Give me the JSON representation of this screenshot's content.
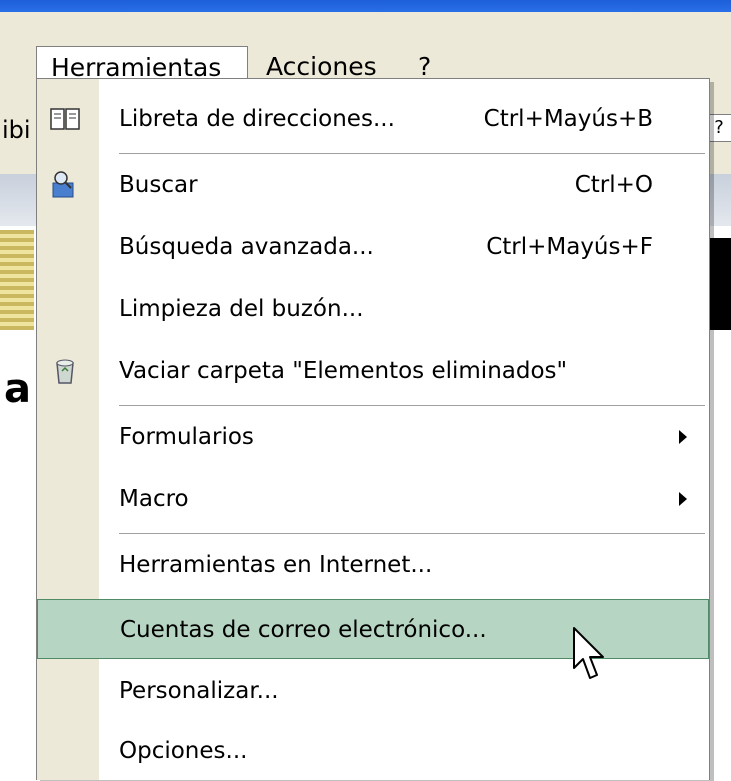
{
  "menubar": {
    "items": [
      {
        "label": "Herramientas"
      },
      {
        "label": "Acciones"
      },
      {
        "label": "?"
      }
    ]
  },
  "background": {
    "left_fragment": "ibi",
    "big_letter": "a",
    "help_glyph": "?"
  },
  "menu": {
    "items": [
      {
        "label": "Libreta de direcciones...",
        "shortcut": "Ctrl+Mayús+B",
        "icon": "address-book-icon"
      },
      {
        "label": "Buscar",
        "shortcut": "Ctrl+O",
        "icon": "find-icon"
      },
      {
        "label": "Búsqueda avanzada...",
        "shortcut": "Ctrl+Mayús+F"
      },
      {
        "label": "Limpieza del buzón..."
      },
      {
        "label": "Vaciar carpeta \"Elementos eliminados\"",
        "icon": "recycle-bin-icon"
      },
      {
        "label": "Formularios",
        "submenu": true
      },
      {
        "label": "Macro",
        "submenu": true
      },
      {
        "label": "Herramientas en Internet..."
      },
      {
        "label": "Cuentas de correo electrónico...",
        "selected": true
      },
      {
        "label": "Personalizar..."
      },
      {
        "label": "Opciones..."
      }
    ]
  },
  "colors": {
    "highlight": "#b6d6c3",
    "highlight_border": "#4e8b66",
    "gutter": "#ece9d8",
    "titlebar": "#2a6ee8"
  }
}
